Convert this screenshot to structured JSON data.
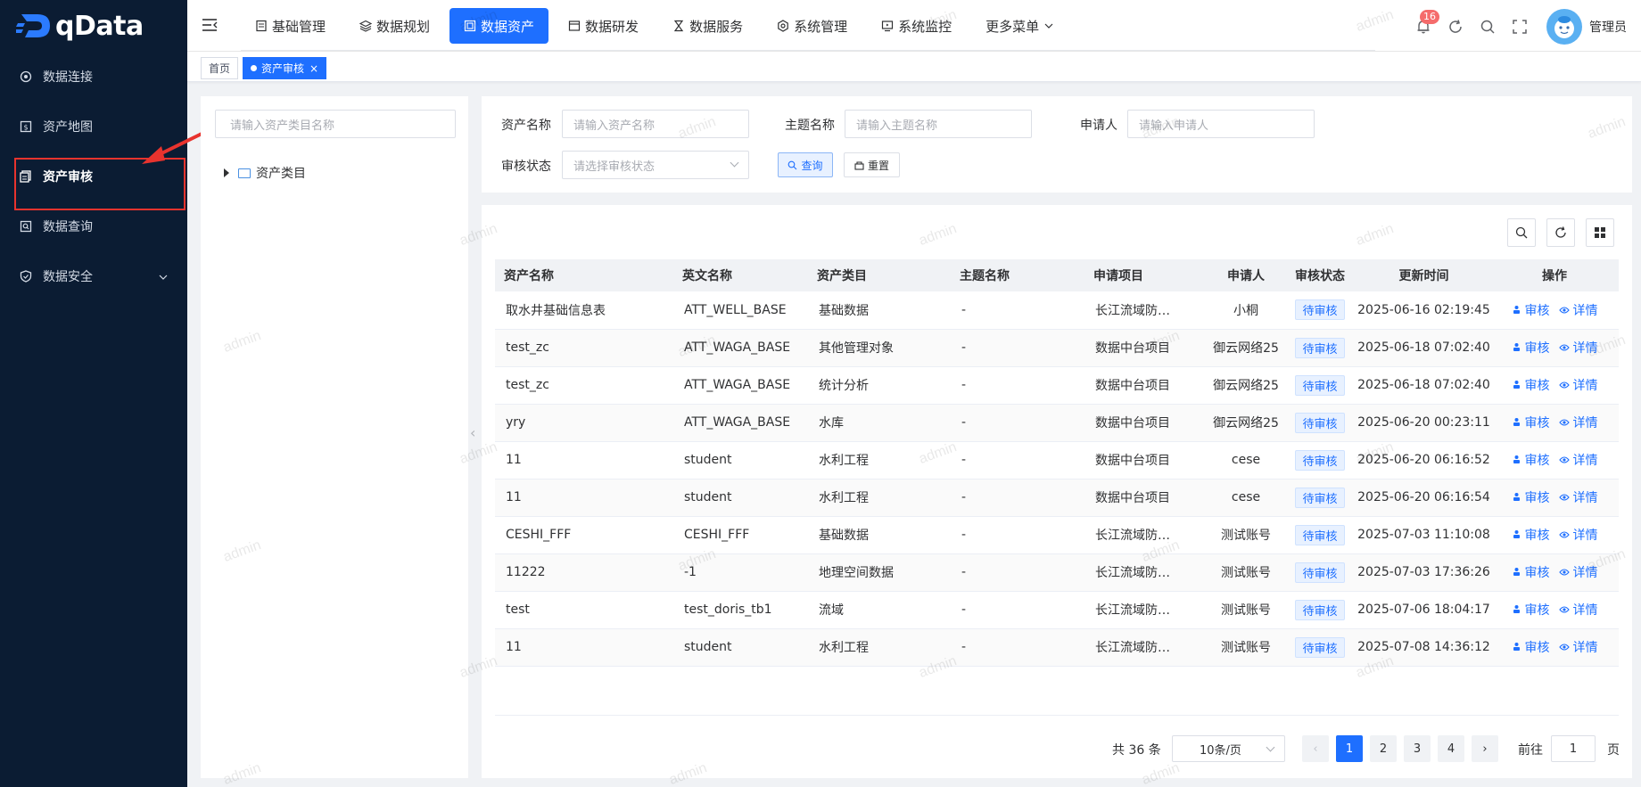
{
  "app": {
    "name": "qData"
  },
  "sidebar": {
    "items": [
      {
        "label": "数据连接",
        "icon": "connection-icon"
      },
      {
        "label": "资产地图",
        "icon": "map-icon"
      },
      {
        "label": "资产审核",
        "icon": "audit-icon",
        "active": true
      },
      {
        "label": "数据查询",
        "icon": "query-icon"
      },
      {
        "label": "数据安全",
        "icon": "shield-icon",
        "has_children": true
      }
    ]
  },
  "topnav": {
    "items": [
      {
        "label": "基础管理",
        "icon": "doc-icon"
      },
      {
        "label": "数据规划",
        "icon": "layers-icon"
      },
      {
        "label": "数据资产",
        "icon": "asset-icon",
        "active": true
      },
      {
        "label": "数据研发",
        "icon": "window-icon"
      },
      {
        "label": "数据服务",
        "icon": "hourglass-icon"
      },
      {
        "label": "系统管理",
        "icon": "settings-icon"
      },
      {
        "label": "系统监控",
        "icon": "monitor-icon"
      },
      {
        "label": "更多菜单",
        "icon": "chevron-down-icon"
      }
    ]
  },
  "header": {
    "notification_count": "16",
    "user_name": "管理员"
  },
  "tags": {
    "home": "首页",
    "current": "资产审核"
  },
  "tree": {
    "search_placeholder": "请输入资产类目名称",
    "root_label": "资产类目"
  },
  "query": {
    "asset_name_label": "资产名称",
    "asset_name_placeholder": "请输入资产名称",
    "theme_name_label": "主题名称",
    "theme_name_placeholder": "请输入主题名称",
    "applicant_label": "申请人",
    "applicant_placeholder": "请输入申请人",
    "status_label": "审核状态",
    "status_placeholder": "请选择审核状态",
    "search_btn": "查询",
    "reset_btn": "重置"
  },
  "table": {
    "columns": [
      "资产名称",
      "英文名称",
      "资产类目",
      "主题名称",
      "申请项目",
      "申请人",
      "审核状态",
      "更新时间",
      "操作"
    ],
    "audit_label": "审核",
    "detail_label": "详情",
    "rows": [
      {
        "name": "取水井基础信息表",
        "en": "ATT_WELL_BASE",
        "category": "基础数据",
        "theme": "-",
        "project": "长江流域防…",
        "applicant": "小桐",
        "status": "待审核",
        "time": "2025-06-16 02:19:45"
      },
      {
        "name": "test_zc",
        "en": "ATT_WAGA_BASE",
        "category": "其他管理对象",
        "theme": "-",
        "project": "数据中台项目",
        "applicant": "御云网络25",
        "status": "待审核",
        "time": "2025-06-18 07:02:40"
      },
      {
        "name": "test_zc",
        "en": "ATT_WAGA_BASE",
        "category": "统计分析",
        "theme": "-",
        "project": "数据中台项目",
        "applicant": "御云网络25",
        "status": "待审核",
        "time": "2025-06-18 07:02:40"
      },
      {
        "name": "yry",
        "en": "ATT_WAGA_BASE",
        "category": "水库",
        "theme": "-",
        "project": "数据中台项目",
        "applicant": "御云网络25",
        "status": "待审核",
        "time": "2025-06-20 00:23:11"
      },
      {
        "name": "11",
        "en": "student",
        "category": "水利工程",
        "theme": "-",
        "project": "数据中台项目",
        "applicant": "cese",
        "status": "待审核",
        "time": "2025-06-20 06:16:52"
      },
      {
        "name": "11",
        "en": "student",
        "category": "水利工程",
        "theme": "-",
        "project": "数据中台项目",
        "applicant": "cese",
        "status": "待审核",
        "time": "2025-06-20 06:16:54"
      },
      {
        "name": "CESHI_FFF",
        "en": "CESHI_FFF",
        "category": "基础数据",
        "theme": "-",
        "project": "长江流域防…",
        "applicant": "测试账号",
        "status": "待审核",
        "time": "2025-07-03 11:10:08"
      },
      {
        "name": "11222",
        "en": "-1",
        "category": "地理空间数据",
        "theme": "-",
        "project": "长江流域防…",
        "applicant": "测试账号",
        "status": "待审核",
        "time": "2025-07-03 17:36:26"
      },
      {
        "name": "test",
        "en": "test_doris_tb1",
        "category": "流域",
        "theme": "-",
        "project": "长江流域防…",
        "applicant": "测试账号",
        "status": "待审核",
        "time": "2025-07-06 18:04:17"
      },
      {
        "name": "11",
        "en": "student",
        "category": "水利工程",
        "theme": "-",
        "project": "长江流域防…",
        "applicant": "测试账号",
        "status": "待审核",
        "time": "2025-07-08 14:36:12"
      }
    ]
  },
  "pagination": {
    "total": "共 36 条",
    "page_size": "10条/页",
    "pages": [
      "1",
      "2",
      "3",
      "4"
    ],
    "current": "1",
    "goto_label": "前往",
    "goto_value": "1",
    "page_suffix": "页"
  },
  "watermark": "admin",
  "colors": {
    "primary": "#1e6fff",
    "sidebar_bg": "#0b1c33",
    "highlight": "#e8332e"
  }
}
